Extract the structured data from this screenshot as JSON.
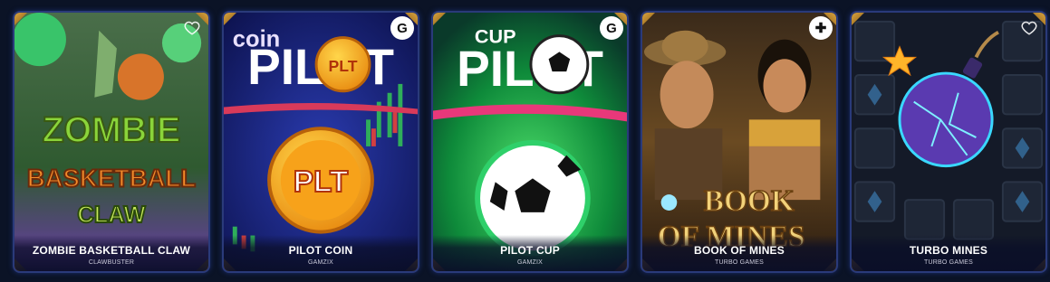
{
  "games": [
    {
      "title": "ZOMBIE BASKETBALL CLAW",
      "provider": "CLAWBUSTER",
      "art_text": [
        "ZOMBIE",
        "BASKETBALL",
        "CLAW"
      ]
    },
    {
      "title": "PILOT COIN",
      "provider": "GAMZIX",
      "art_text": [
        "coin",
        "PILOT",
        "PLT",
        "PLT"
      ]
    },
    {
      "title": "PILOT CUP",
      "provider": "GAMZIX",
      "art_text": [
        "CUP",
        "PILOT"
      ]
    },
    {
      "title": "BOOK OF MINES",
      "provider": "TURBO GAMES",
      "art_text": [
        "BOOK",
        "OF MINES"
      ]
    },
    {
      "title": "TURBO MINES",
      "provider": "TURBO GAMES",
      "art_text": []
    }
  ],
  "icons": {
    "favorite": "heart-icon",
    "provider_badge": "gamzix-logo-icon"
  },
  "colors": {
    "background": "#0b1326",
    "card_border": "#2a3a7a",
    "corner_gold": "#d9a441",
    "title_text": "#ffffff",
    "provider_text": "#c9c9d9"
  }
}
